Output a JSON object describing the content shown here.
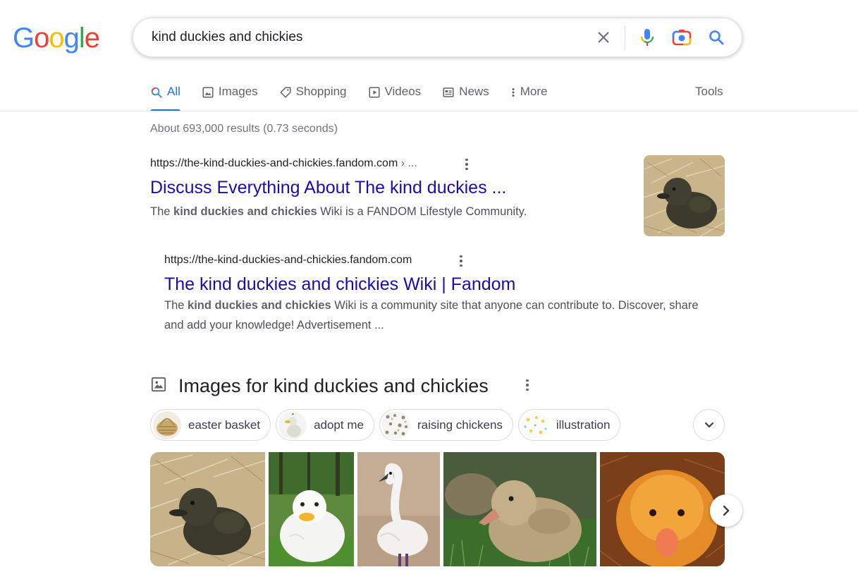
{
  "logo": {
    "letters": [
      "G",
      "o",
      "o",
      "g",
      "l",
      "e"
    ],
    "colors": [
      "#4285F4",
      "#EA4335",
      "#FBBC05",
      "#4285F4",
      "#34A853",
      "#EA4335"
    ]
  },
  "search": {
    "query": "kind duckies and chickies",
    "icons": [
      "close-icon",
      "mic-icon",
      "camera-icon",
      "search-icon"
    ]
  },
  "tabs": [
    {
      "label": "All",
      "icon": "search-icon"
    },
    {
      "label": "Images",
      "icon": "image-icon"
    },
    {
      "label": "Shopping",
      "icon": "tag-icon"
    },
    {
      "label": "Videos",
      "icon": "play-icon"
    },
    {
      "label": "News",
      "icon": "news-icon"
    },
    {
      "label": "More",
      "icon": "kebab-icon"
    }
  ],
  "tools_label": "Tools",
  "stats": "About 693,000 results (0.73 seconds)",
  "results": [
    {
      "url": "https://the-kind-duckies-and-chickies.fandom.com",
      "breadcrumb": " › ...",
      "title": "Discuss Everything About The kind duckies ...",
      "snippet_pre": "The ",
      "snippet_bold": "kind duckies and chickies",
      "snippet_post": " Wiki is a FANDOM Lifestyle Community."
    },
    {
      "url": "https://the-kind-duckies-and-chickies.fandom.com",
      "title": "The kind duckies and chickies Wiki | Fandom",
      "snippet_pre": "The ",
      "snippet_bold": "kind duckies and chickies",
      "snippet_post": " Wiki is a community site that anyone can contribute to. Discover, share and add your knowledge! Advertisement ..."
    }
  ],
  "images_section": {
    "title": "Images for kind duckies and chickies",
    "chips": [
      "easter basket",
      "adopt me",
      "raising chickens",
      "illustration"
    ]
  },
  "accent": "#1a73e8",
  "link_color": "#1a0dab"
}
